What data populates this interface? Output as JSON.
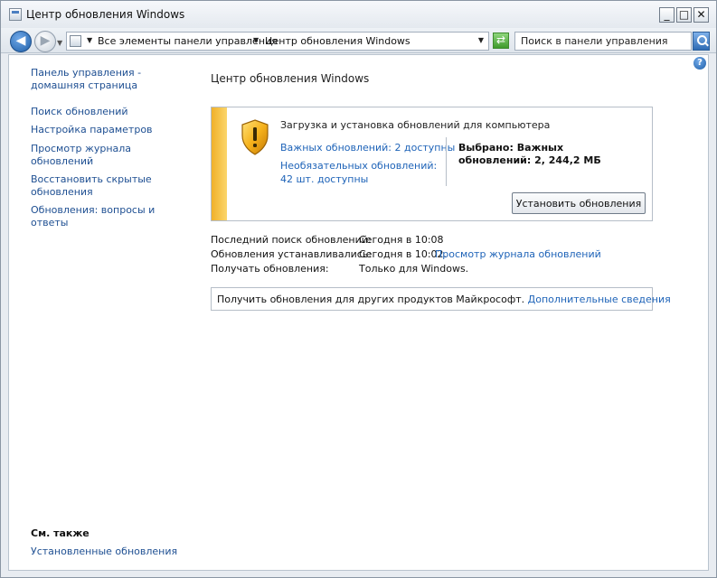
{
  "window": {
    "title": "Центр обновления Windows",
    "buttons": [
      "_",
      "□",
      "✕"
    ]
  },
  "address": {
    "segment1": "Все элементы панели управления",
    "segment2": "Центр обновления Windows",
    "search_placeholder": "Поиск в панели управления"
  },
  "sidebar": {
    "home_link": [
      "Панель управления -",
      "домашняя страница"
    ],
    "links": [
      [
        "Поиск обновлений"
      ],
      [
        "Настройка параметров"
      ],
      [
        "Просмотр журнала",
        "обновлений"
      ],
      [
        "Восстановить скрытые",
        "обновления"
      ],
      [
        "Обновления: вопросы и",
        "ответы"
      ]
    ],
    "see_also_title": "См. также",
    "see_also_link": "Установленные обновления"
  },
  "main": {
    "title": "Центр обновления Windows",
    "panel": {
      "heading": "Загрузка и установка обновлений для компьютера",
      "important_link": "Важных обновлений: 2 доступны",
      "optional_link": "Необязательных обновлений: 42 шт. доступны",
      "selected": "Выбрано: Важных обновлений: 2, 244,2 МБ",
      "install_button": "Установить обновления"
    },
    "info": {
      "last_search_label": "Последний поиск обновлений:",
      "last_search_value": "Сегодня в 10:08",
      "installed_label": "Обновления устанавливались:",
      "installed_value": "Сегодня в 10:02.",
      "journal_link": "Просмотр журнала обновлений",
      "receive_label": "Получать обновления:",
      "receive_value": "Только для Windows."
    },
    "other_products": {
      "text": "Получить обновления для других продуктов Майкрософт.",
      "link": "Дополнительные сведения"
    }
  }
}
